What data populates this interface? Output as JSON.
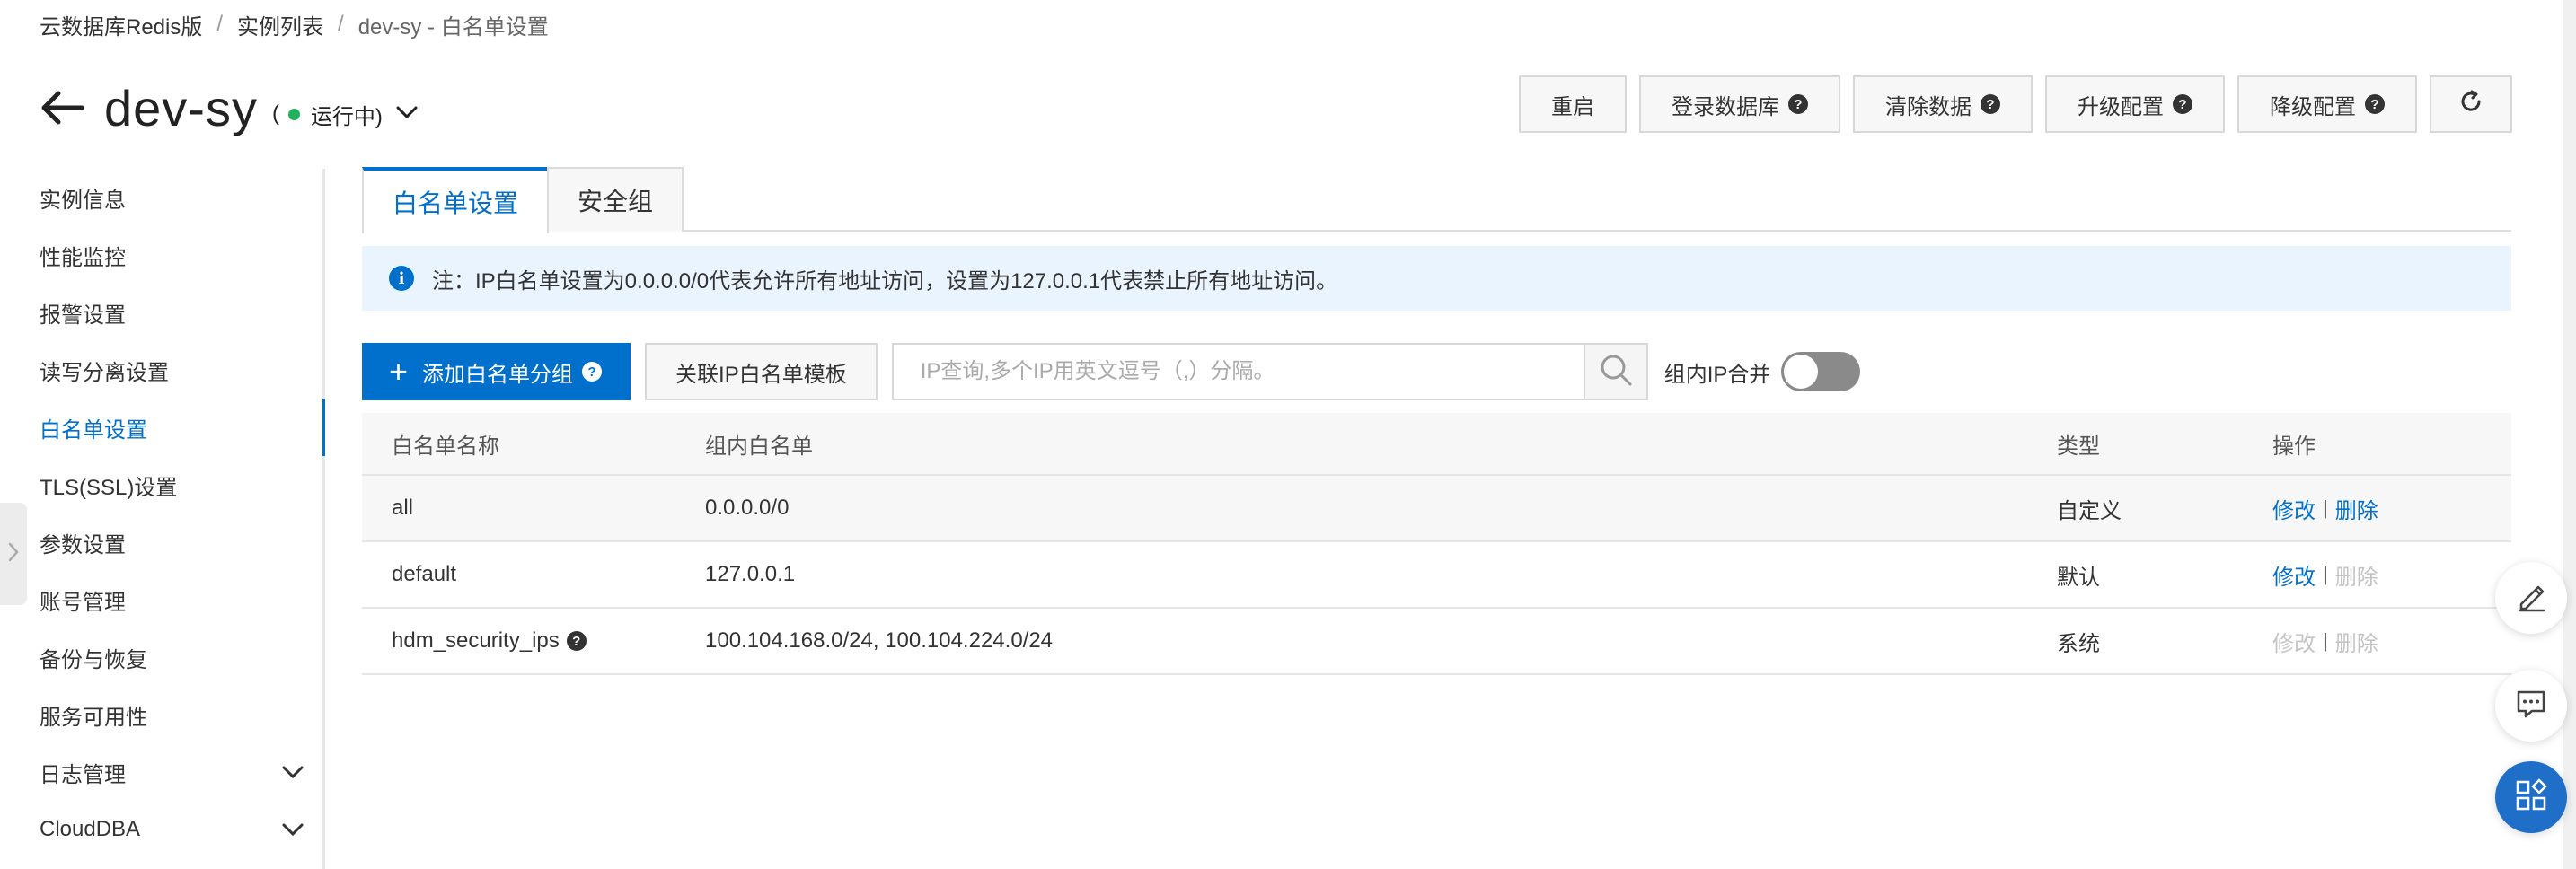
{
  "breadcrumb": {
    "items": [
      "云数据库Redis版",
      "实例列表",
      "dev-sy - 白名单设置"
    ],
    "separator": "/"
  },
  "header": {
    "title": "dev-sy",
    "status_open": "(",
    "status_text": "运行中)",
    "status_color": "#1fb25a"
  },
  "actions": {
    "restart": "重启",
    "login_db": "登录数据库",
    "clear_data": "清除数据",
    "upgrade": "升级配置",
    "downgrade": "降级配置",
    "help_glyph": "?"
  },
  "sidebar": {
    "items": [
      {
        "label": "实例信息"
      },
      {
        "label": "性能监控"
      },
      {
        "label": "报警设置"
      },
      {
        "label": "读写分离设置"
      },
      {
        "label": "白名单设置"
      },
      {
        "label": "TLS(SSL)设置"
      },
      {
        "label": "参数设置"
      },
      {
        "label": "账号管理"
      },
      {
        "label": "备份与恢复"
      },
      {
        "label": "服务可用性"
      },
      {
        "label": "日志管理"
      },
      {
        "label": "CloudDBA"
      }
    ],
    "active_index": 4
  },
  "tabs": {
    "whitelist": "白名单设置",
    "security_group": "安全组"
  },
  "notice": {
    "icon": "i",
    "text": "注：IP白名单设置为0.0.0.0/0代表允许所有地址访问，设置为127.0.0.1代表禁止所有地址访问。"
  },
  "toolbar": {
    "add_group": "添加白名单分组",
    "link_template": "关联IP白名单模板",
    "search_placeholder": "IP查询,多个IP用英文逗号（,）分隔。",
    "merge_label": "组内IP合并",
    "merge_enabled": false
  },
  "table": {
    "headers": [
      "白名单名称",
      "组内白名单",
      "类型",
      "操作"
    ],
    "rows": [
      {
        "name": "all",
        "ips": "0.0.0.0/0",
        "type": "自定义",
        "edit": "修改",
        "delete": "删除",
        "edit_enabled": true,
        "delete_enabled": true
      },
      {
        "name": "default",
        "ips": "127.0.0.1",
        "type": "默认",
        "edit": "修改",
        "delete": "删除",
        "edit_enabled": true,
        "delete_enabled": false
      },
      {
        "name": "hdm_security_ips",
        "ips": "100.104.168.0/24, 100.104.224.0/24",
        "type": "系统",
        "edit": "修改",
        "delete": "删除",
        "edit_enabled": false,
        "delete_enabled": false
      }
    ],
    "op_separator": "|"
  },
  "colors": {
    "accent": "#0070cc",
    "disabled": "#c4c4c4",
    "notice_bg": "#e9f4ff"
  }
}
